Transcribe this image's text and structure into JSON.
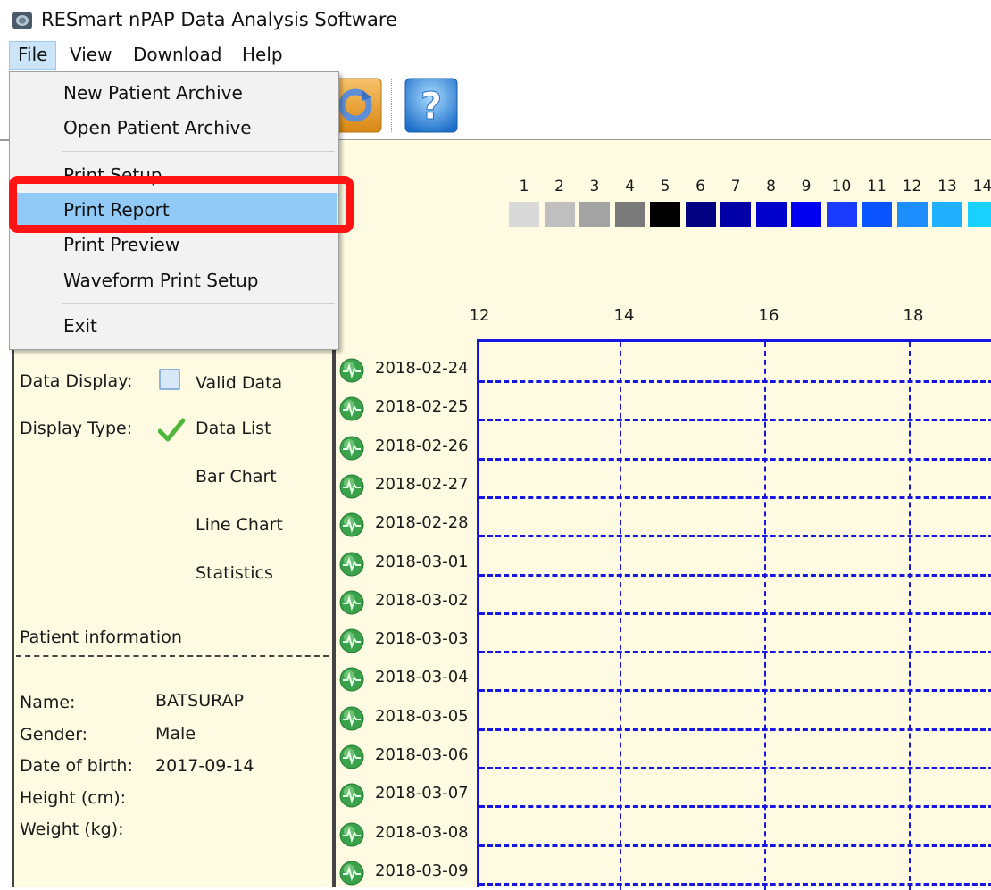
{
  "window": {
    "title": "RESmart nPAP Data Analysis Software"
  },
  "menubar": {
    "items": [
      "File",
      "View",
      "Download",
      "Help"
    ],
    "active": "File"
  },
  "file_menu": {
    "items": [
      {
        "label": "New Patient Archive"
      },
      {
        "label": "Open Patient Archive"
      },
      {
        "label": "Print Setup"
      },
      {
        "label": "Print Report",
        "highlighted": true
      },
      {
        "label": "Print Preview"
      },
      {
        "label": "Waveform Print Setup"
      },
      {
        "label": "Exit"
      }
    ],
    "annotation_color": "#ff1313"
  },
  "toolbar": {
    "icons": [
      "refresh-icon",
      "help-icon"
    ]
  },
  "left_panel": {
    "data_display_label": "Data Display:",
    "data_display_value": "Valid Data",
    "display_type_label": "Display Type:",
    "display_type_options": [
      "Data List",
      "Bar Chart",
      "Line Chart",
      "Statistics"
    ],
    "display_type_selected": "Data List",
    "patient_info_header": "Patient information",
    "patient": {
      "name_label": "Name:",
      "name": "BATSURAP",
      "gender_label": "Gender:",
      "gender": "Male",
      "dob_label": "Date of birth:",
      "dob": "2017-09-14",
      "height_label": "Height (cm):",
      "height": "",
      "weight_label": "Weight (kg):",
      "weight": ""
    }
  },
  "legend": {
    "numbers": [
      "1",
      "2",
      "3",
      "4",
      "5",
      "6",
      "7",
      "8",
      "9",
      "10",
      "11",
      "12",
      "13",
      "14"
    ],
    "colors": [
      "#d9d9d9",
      "#bfbfbf",
      "#a3a3a3",
      "#7a7a7a",
      "#000000",
      "#000080",
      "#0000a6",
      "#0000cc",
      "#0000f0",
      "#1a3cff",
      "#0a55ff",
      "#1e8eff",
      "#20b0ff",
      "#1ad0ff"
    ]
  },
  "chart": {
    "hour_ticks": [
      "12",
      "14",
      "16",
      "18"
    ],
    "dates": [
      "2018-02-24",
      "2018-02-25",
      "2018-02-26",
      "2018-02-27",
      "2018-02-28",
      "2018-03-01",
      "2018-03-02",
      "2018-03-03",
      "2018-03-04",
      "2018-03-05",
      "2018-03-06",
      "2018-03-07",
      "2018-03-08",
      "2018-03-09"
    ],
    "line_color": "#1616e0"
  }
}
